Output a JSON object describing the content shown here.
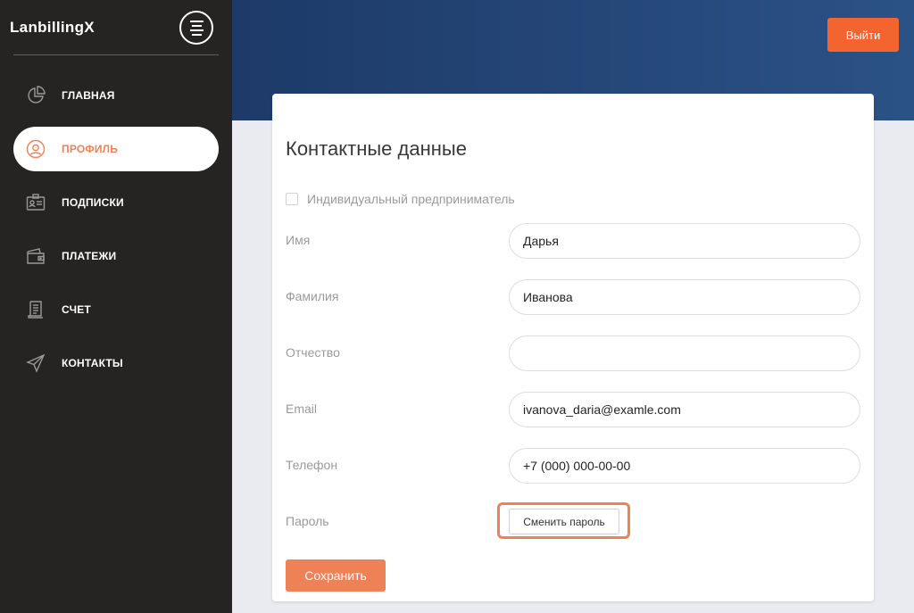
{
  "app": {
    "brand": "LanbillingX"
  },
  "sidebar": {
    "items": [
      {
        "label": "ГЛАВНАЯ",
        "icon": "pie-chart-icon",
        "active": false
      },
      {
        "label": "ПРОФИЛЬ",
        "icon": "user-circle-icon",
        "active": true
      },
      {
        "label": "ПОДПИСКИ",
        "icon": "id-card-icon",
        "active": false
      },
      {
        "label": "ПЛАТЕЖИ",
        "icon": "wallet-icon",
        "active": false
      },
      {
        "label": "СЧЕТ",
        "icon": "receipt-icon",
        "active": false
      },
      {
        "label": "КОНТАКТЫ",
        "icon": "paper-plane-icon",
        "active": false
      }
    ]
  },
  "header": {
    "logout_label": "Выйти"
  },
  "form": {
    "title": "Контактные данные",
    "entrepreneur_label": "Индивидуальный предприниматель",
    "entrepreneur_checked": false,
    "fields": [
      {
        "label": "Имя",
        "value": "Дарья"
      },
      {
        "label": "Фамилия",
        "value": "Иванова"
      },
      {
        "label": "Отчество",
        "value": ""
      },
      {
        "label": "Email",
        "value": "ivanova_daria@examle.com"
      },
      {
        "label": "Телефон",
        "value": "+7 (000) 000-00-00"
      }
    ],
    "password_label": "Пароль",
    "change_password_label": "Сменить пароль",
    "save_label": "Сохранить"
  },
  "colors": {
    "accent": "#ef8157",
    "logout": "#f4642f",
    "sidebar_bg": "#252422",
    "header_gradient_start": "#1d3a68",
    "header_gradient_end": "#2b5286"
  }
}
